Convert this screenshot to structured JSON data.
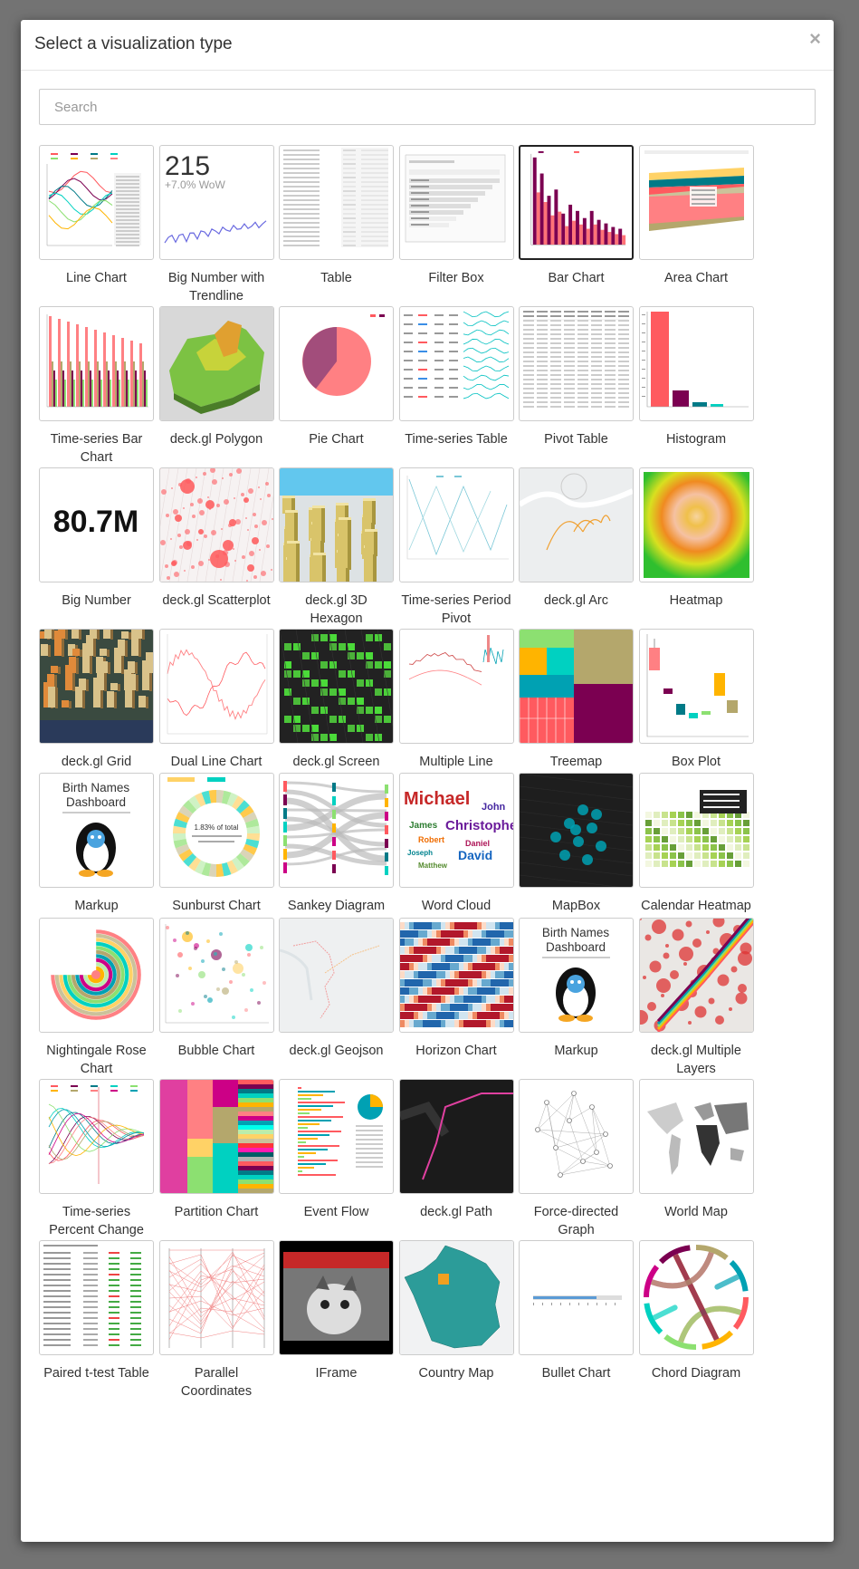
{
  "dialog": {
    "title": "Select a visualization type",
    "close_glyph": "×",
    "search_placeholder": "Search"
  },
  "thumb_text": {
    "big_number_trend_value": "215",
    "big_number_trend_delta": "+7.0% WoW",
    "big_number_value": "80.7M",
    "markup_title": "Birth Names Dashboard",
    "sunburst_pct": "1.83% of total"
  },
  "tiles": [
    {
      "label": "Line Chart",
      "thumb": "line"
    },
    {
      "label": "Big Number with Trendline",
      "thumb": "bignum-trend"
    },
    {
      "label": "Table",
      "thumb": "table"
    },
    {
      "label": "Filter Box",
      "thumb": "filter"
    },
    {
      "label": "Bar Chart",
      "thumb": "bar",
      "selected": true
    },
    {
      "label": "Area Chart",
      "thumb": "area"
    },
    {
      "label": "Time-series Bar Chart",
      "thumb": "tsbar"
    },
    {
      "label": "deck.gl Polygon",
      "thumb": "polygon"
    },
    {
      "label": "Pie Chart",
      "thumb": "pie"
    },
    {
      "label": "Time-series Table",
      "thumb": "tstable"
    },
    {
      "label": "Pivot Table",
      "thumb": "pivot"
    },
    {
      "label": "Histogram",
      "thumb": "histogram"
    },
    {
      "label": "Big Number",
      "thumb": "bignum"
    },
    {
      "label": "deck.gl Scatterplot",
      "thumb": "scatter-map"
    },
    {
      "label": "deck.gl 3D Hexagon",
      "thumb": "hexagon"
    },
    {
      "label": "Time-series Period Pivot",
      "thumb": "period"
    },
    {
      "label": "deck.gl Arc",
      "thumb": "arc"
    },
    {
      "label": "Heatmap",
      "thumb": "heatmap"
    },
    {
      "label": "deck.gl Grid",
      "thumb": "grid3d"
    },
    {
      "label": "Dual Line Chart",
      "thumb": "dualline"
    },
    {
      "label": "deck.gl Screen Grid",
      "thumb": "screengrid"
    },
    {
      "label": "Multiple Line Charts",
      "thumb": "multiline"
    },
    {
      "label": "Treemap",
      "thumb": "treemap"
    },
    {
      "label": "Box Plot",
      "thumb": "boxplot"
    },
    {
      "label": "Markup",
      "thumb": "markup"
    },
    {
      "label": "Sunburst Chart",
      "thumb": "sunburst"
    },
    {
      "label": "Sankey Diagram",
      "thumb": "sankey"
    },
    {
      "label": "Word Cloud",
      "thumb": "wordcloud"
    },
    {
      "label": "MapBox",
      "thumb": "mapbox"
    },
    {
      "label": "Calendar Heatmap",
      "thumb": "calendar"
    },
    {
      "label": "Nightingale Rose Chart",
      "thumb": "rose"
    },
    {
      "label": "Bubble Chart",
      "thumb": "bubble"
    },
    {
      "label": "deck.gl Geojson",
      "thumb": "geojson"
    },
    {
      "label": "Horizon Chart",
      "thumb": "horizon"
    },
    {
      "label": "Markup",
      "thumb": "markup"
    },
    {
      "label": "deck.gl Multiple Layers",
      "thumb": "multilayer"
    },
    {
      "label": "Time-series Percent Change",
      "thumb": "pctchange"
    },
    {
      "label": "Partition Chart",
      "thumb": "partition"
    },
    {
      "label": "Event Flow",
      "thumb": "eventflow"
    },
    {
      "label": "deck.gl Path",
      "thumb": "path"
    },
    {
      "label": "Force-directed Graph",
      "thumb": "force"
    },
    {
      "label": "World Map",
      "thumb": "worldmap"
    },
    {
      "label": "Paired t-test Table",
      "thumb": "ttest"
    },
    {
      "label": "Parallel Coordinates",
      "thumb": "parallel"
    },
    {
      "label": "IFrame",
      "thumb": "iframe"
    },
    {
      "label": "Country Map",
      "thumb": "countrymap"
    },
    {
      "label": "Bullet Chart",
      "thumb": "bullet"
    },
    {
      "label": "Chord Diagram",
      "thumb": "chord"
    }
  ]
}
